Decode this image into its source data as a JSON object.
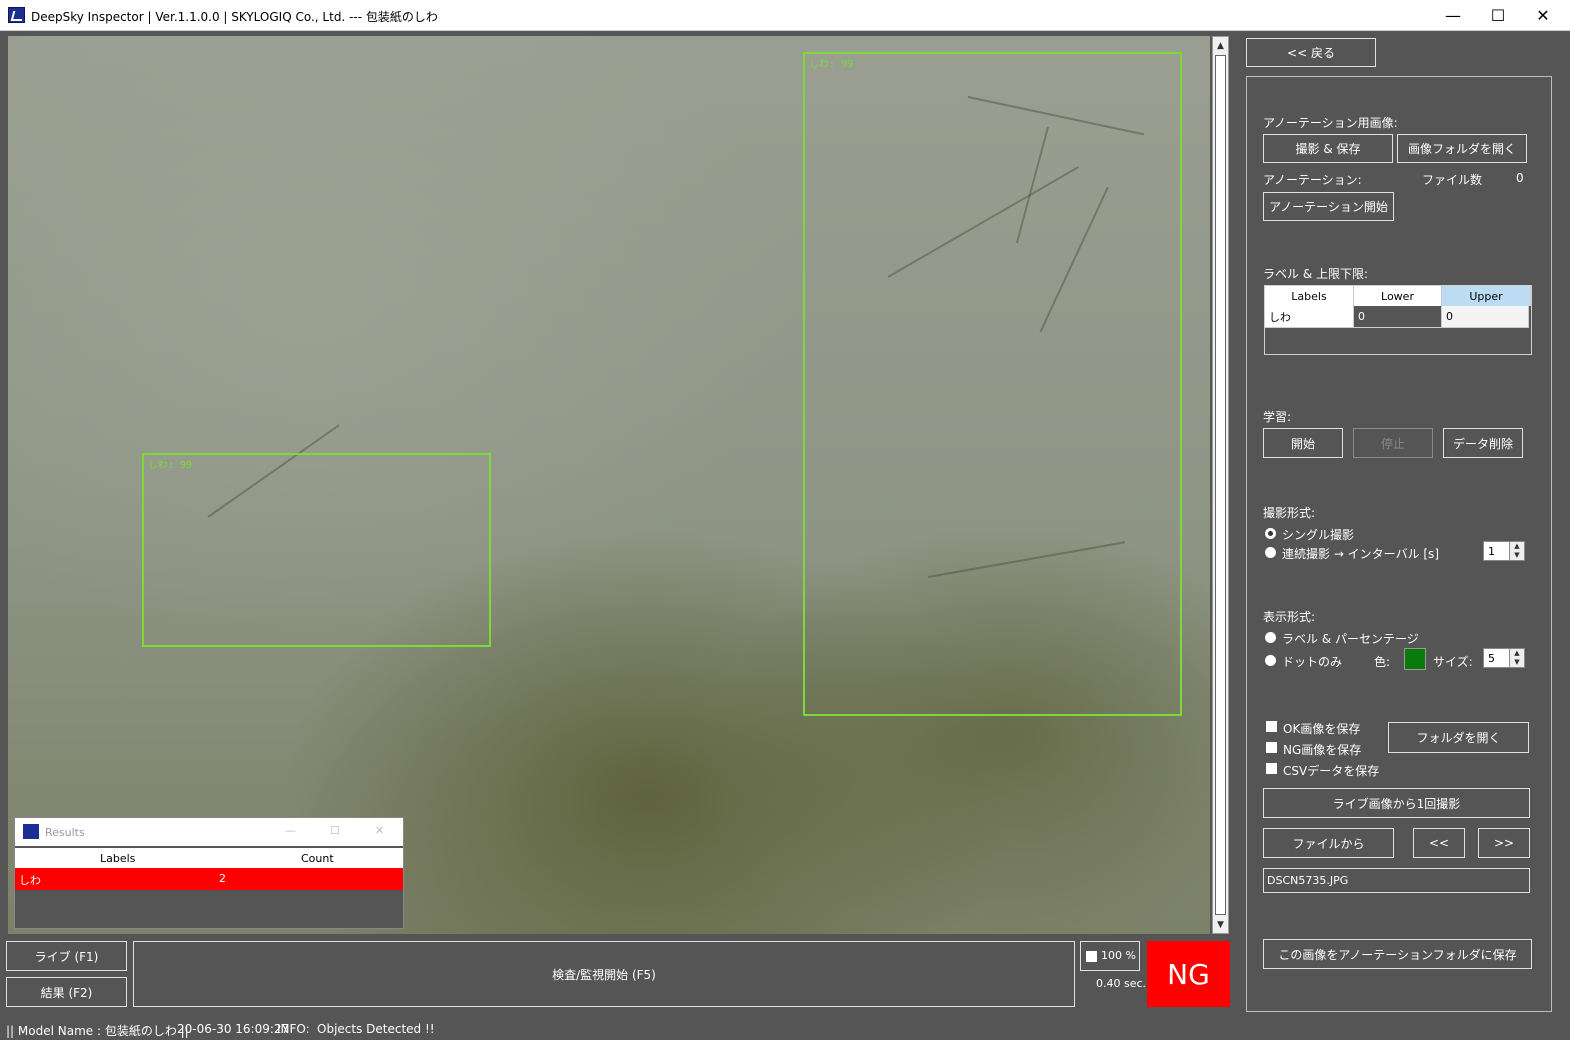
{
  "window": {
    "title": "DeepSky Inspector | Ver.1.1.0.0 | SKYLOGIQ Co., Ltd. --- 包装紙のしわ",
    "minimize_glyph": "—",
    "maximize_glyph": "☐",
    "close_glyph": "✕"
  },
  "detections": [
    {
      "label": "しわ: 99"
    },
    {
      "label": "しわ: 99"
    }
  ],
  "results_window": {
    "title": "Results",
    "columns": [
      "Labels",
      "Count"
    ],
    "rows": [
      {
        "label": "しわ",
        "count": "2"
      }
    ]
  },
  "bottom": {
    "live_button": "ライブ (F1)",
    "result_button": "結果 (F2)",
    "start_button": "検査/監視開始 (F5)",
    "zoom": "100 %",
    "elapsed": "0.40 sec.",
    "verdict": "NG",
    "verdict_color": "#ff0000"
  },
  "panel": {
    "back_button": "<< 戻る",
    "annot_image_label": "アノーテーション用画像:",
    "capture_save_button": "撮影 & 保存",
    "open_image_folder_button": "画像フォルダを開く",
    "annotation_label": "アノーテーション:",
    "file_count_label": "ファイル数",
    "file_count": "0",
    "annotation_start_button": "アノーテーション開始",
    "label_limits_label": "ラベル & 上限下限:",
    "grid": {
      "columns": [
        "Labels",
        "Lower",
        "Upper"
      ],
      "rows": [
        {
          "label": "しわ",
          "lower": "0",
          "upper": "0"
        }
      ]
    },
    "learning_label": "学習:",
    "learn_start_button": "開始",
    "learn_stop_button": "停止",
    "data_delete_button": "データ削除",
    "capture_mode_label": "撮影形式:",
    "single_capture": "シングル撮影",
    "continuous_capture": "連続撮影 → インターバル [s]",
    "interval_value": "1",
    "display_mode_label": "表示形式:",
    "label_percent": "ラベル & パーセンテージ",
    "dot_only": "ドットのみ",
    "color_label": "色:",
    "dot_color": "#0a7a0a",
    "size_label": "サイズ:",
    "size_value": "5",
    "save_ok": "OK画像を保存",
    "save_ng": "NG画像を保存",
    "save_csv": "CSVデータを保存",
    "open_folder_button": "フォルダを開く",
    "capture_once_button": "ライブ画像から1回撮影",
    "from_file_button": "ファイルから",
    "prev_button": "<<",
    "next_button": ">>",
    "file_name": "DSCN5735.JPG",
    "save_to_annot_button": "この画像をアノーテーションフォルダに保存"
  },
  "status": {
    "model": "|| Model Name : 包装紙のしわ ||",
    "timestamp": "20-06-30 16:09:27",
    "info_label": "INFO:",
    "info_text": "Objects Detected !!"
  }
}
